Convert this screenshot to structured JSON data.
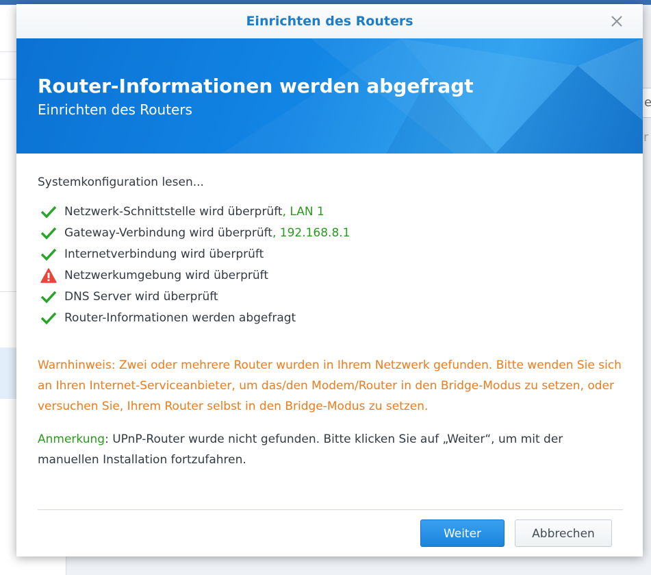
{
  "background": {
    "right_field_1_text": "e",
    "right_field_2_text": "r"
  },
  "dialog": {
    "title": "Einrichten des Routers",
    "close_icon": "close-icon"
  },
  "banner": {
    "title": "Router-Informationen werden abgefragt",
    "subtitle": "Einrichten des Routers",
    "color": "#1285e4"
  },
  "content": {
    "intro": "Systemkonfiguration lesen...",
    "checks": [
      {
        "status": "ok",
        "icon": "checkmark-icon",
        "text": "Netzwerk-Schnittstelle wird überprüft",
        "suffix": ", LAN 1"
      },
      {
        "status": "ok",
        "icon": "checkmark-icon",
        "text": "Gateway-Verbindung wird überprüft",
        "suffix": ", 192.168.8.1"
      },
      {
        "status": "ok",
        "icon": "checkmark-icon",
        "text": "Internetverbindung wird überprüft",
        "suffix": ""
      },
      {
        "status": "warning",
        "icon": "warning-icon",
        "text": "Netzwerkumgebung wird überprüft",
        "suffix": ""
      },
      {
        "status": "ok",
        "icon": "checkmark-icon",
        "text": "DNS Server wird überprüft",
        "suffix": ""
      },
      {
        "status": "ok",
        "icon": "checkmark-icon",
        "text": "Router-Informationen werden abgefragt",
        "suffix": ""
      }
    ],
    "warning_text": "Warnhinweis: Zwei oder mehrere Router wurden in Ihrem Netzwerk gefunden. Bitte wenden Sie sich an Ihren Internet-Serviceanbieter, um das/den Modem/Router in den Bridge-Modus zu setzen, oder versuchen Sie, Ihrem Router selbst in den Bridge-Modus zu setzen.",
    "note_label": "Anmerkung",
    "note_text": ": UPnP-Router wurde nicht gefunden. Bitte klicken Sie auf „Weiter“, um mit der manuellen Installation fortzufahren."
  },
  "buttons": {
    "next_label": "Weiter",
    "cancel_label": "Abbrechen"
  },
  "colors": {
    "accent": "#1f7dc8",
    "ok_green": "#2a9a1e",
    "warning_orange": "#ef7b1a",
    "error_red": "#e8453c"
  }
}
